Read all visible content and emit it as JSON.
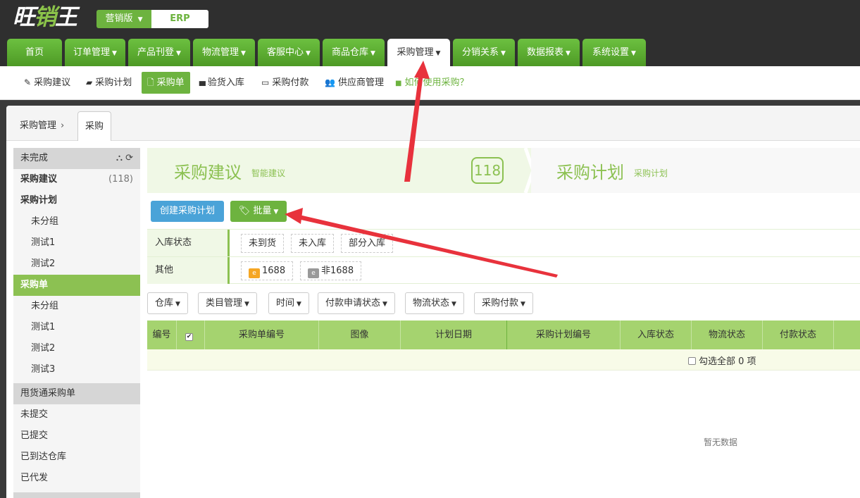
{
  "header": {
    "logo_text": "旺销王",
    "edition_label": "营销版",
    "erp_label": "ERP"
  },
  "main_nav": [
    {
      "label": "首页",
      "dropdown": false
    },
    {
      "label": "订单管理",
      "dropdown": true
    },
    {
      "label": "产品刊登",
      "dropdown": true
    },
    {
      "label": "物流管理",
      "dropdown": true
    },
    {
      "label": "客服中心",
      "dropdown": true
    },
    {
      "label": "商品仓库",
      "dropdown": true
    },
    {
      "label": "采购管理",
      "dropdown": true,
      "active": true
    },
    {
      "label": "分销关系",
      "dropdown": true
    },
    {
      "label": "数据报表",
      "dropdown": true
    },
    {
      "label": "系统设置",
      "dropdown": true
    }
  ],
  "sub_nav": [
    {
      "label": "采购建议",
      "icon": "pencil-icon",
      "glyph": "✎"
    },
    {
      "label": "采购计划",
      "icon": "book-icon",
      "glyph": "▰"
    },
    {
      "label": "采购单",
      "icon": "file-icon",
      "glyph": "🗋",
      "active": true
    },
    {
      "label": "验货入库",
      "icon": "barcode-icon",
      "glyph": "▮▮▮"
    },
    {
      "label": "采购付款",
      "icon": "card-icon",
      "glyph": "▭"
    },
    {
      "label": "供应商管理",
      "icon": "users-icon",
      "glyph": "👥"
    },
    {
      "label": "如何使用采购？",
      "icon": "video-icon",
      "glyph": "■",
      "help": true
    }
  ],
  "breadcrumb": {
    "parent": "采购管理",
    "separator": "›",
    "current_tab": "采购"
  },
  "sidebar": {
    "section_unfinished": "未完成",
    "items": [
      {
        "label": "采购建议",
        "count": "(118)",
        "bold": true
      },
      {
        "label": "采购计划",
        "bold": true
      },
      {
        "label": "未分组",
        "sub": true
      },
      {
        "label": "测试1",
        "sub": true
      },
      {
        "label": "测试2",
        "sub": true
      },
      {
        "label": "采购单",
        "active": true
      },
      {
        "label": "未分组",
        "sub": true
      },
      {
        "label": "测试1",
        "sub": true
      },
      {
        "label": "测试2",
        "sub": true
      },
      {
        "label": "测试3",
        "sub": true
      }
    ],
    "section_yonghuotong": "甩货通采购单",
    "items2": [
      {
        "label": "未提交"
      },
      {
        "label": "已提交"
      },
      {
        "label": "已到达仓库"
      },
      {
        "label": "已代发"
      }
    ]
  },
  "steps": {
    "step1_title": "采购建议",
    "step1_sub": "智能建议",
    "step1_count": "118",
    "step2_title": "采购计划",
    "step2_sub": "采购计划"
  },
  "actions": {
    "create_plan": "创建采购计划",
    "batch": "批量"
  },
  "filters": {
    "stock_status_label": "入库状态",
    "stock_status_options": [
      "未到货",
      "未入库",
      "部分入库"
    ],
    "other_label": "其他",
    "other_options": [
      "1688",
      "非1688"
    ]
  },
  "dropdowns": [
    "仓库",
    "类目管理",
    "时间",
    "付款申请状态",
    "物流状态",
    "采购付款"
  ],
  "table": {
    "columns": [
      "编号",
      "",
      "采购单编号",
      "图像",
      "计划日期",
      "采购计划编号",
      "入库状态",
      "物流状态",
      "付款状态"
    ],
    "select_all": "勾选全部 0 项",
    "empty_text": "暂无数据"
  },
  "colors": {
    "brand_green": "#6db33f",
    "light_green": "#8cc152",
    "header_dark": "#2f2f2f",
    "create_blue": "#4aa3d8",
    "annotation_red": "#e8323c"
  }
}
